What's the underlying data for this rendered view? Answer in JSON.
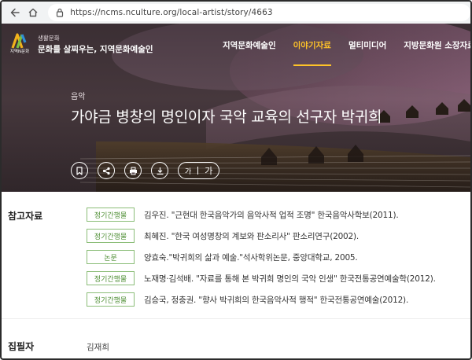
{
  "browser": {
    "url": "https://ncms.nculture.org/local-artist/story/4663",
    "back_icon": "arrow-left-icon",
    "home_icon": "home-icon",
    "lock_icon": "lock-icon"
  },
  "header": {
    "logo_text": "지역N문화",
    "brand_small": "생활문화",
    "brand_main": "문화를 살찌우는, 지역문화예술인",
    "nav": [
      {
        "label": "지역문화예술인",
        "active": false
      },
      {
        "label": "이야기자료",
        "active": true
      },
      {
        "label": "멀티미디어",
        "active": false
      },
      {
        "label": "지방문화원 소장자료",
        "active": false
      }
    ],
    "active_color": "#ffc328"
  },
  "story": {
    "category": "음악",
    "title": "가야금 병창의 명인이자 국악 교육의 선구자 박귀희",
    "font_small": "가",
    "font_large": "가"
  },
  "references": {
    "label": "참고자료",
    "items": [
      {
        "type": "정기간행물",
        "text": "김우진. \"근현대 한국음악가의 음악사적 업적 조명\" 한국음악사학보(2011)."
      },
      {
        "type": "정기간행물",
        "text": "최혜진. \"한국 여성명창의 계보와 판소리사\" 판소리연구(2002)."
      },
      {
        "type": "논문",
        "text": "양효숙.\"박귀희의 삶과 예술.\"석사학위논문, 중앙대학교, 2005."
      },
      {
        "type": "정기간행물",
        "text": "노재명·김석배. \"자료를 통해 본 박귀희 명인의 국악 인생\" 한국전통공연예술학(2012)."
      },
      {
        "type": "정기간행물",
        "text": "김승국, 정충권. \"향사 박귀희의 한국음악사적 행적\" 한국전통공연예술(2012)."
      }
    ],
    "badge_color": "#4f8f35"
  },
  "author": {
    "label": "집필자",
    "name": "김재희"
  }
}
